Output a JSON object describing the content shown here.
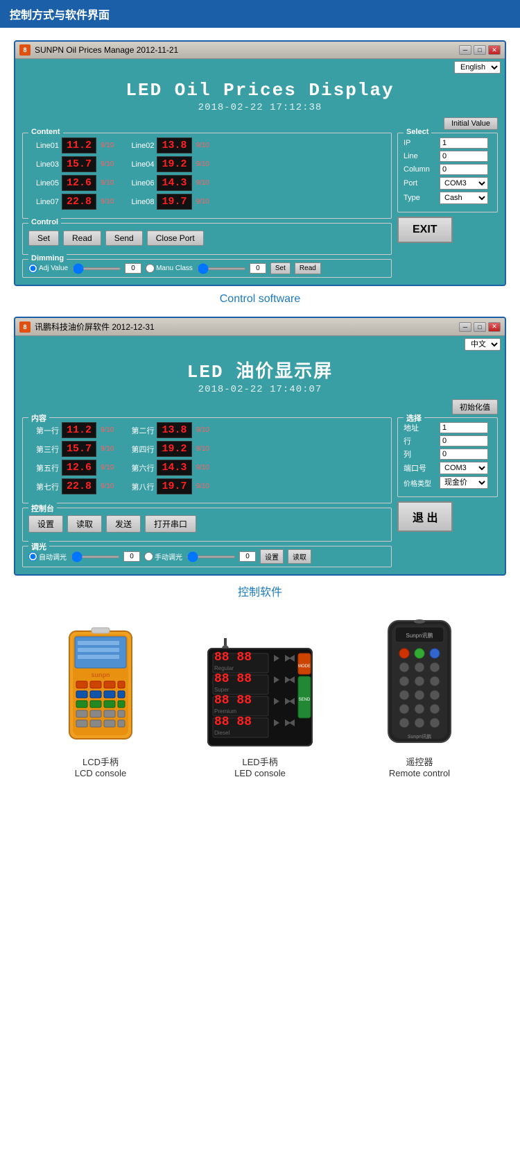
{
  "header": {
    "title": "控制方式与软件界面"
  },
  "window1": {
    "titlebar": "SUNPN Oil Prices Manage 2012-11-21",
    "lang": "English",
    "main_title": "LED Oil Prices Display",
    "datetime": "2018-02-22    17:12:38",
    "initial_value_btn": "Initial Value",
    "content_label": "Content",
    "lines": [
      {
        "label": "Line01",
        "price": "11.2",
        "fraction": "9/10"
      },
      {
        "label": "Line02",
        "price": "13.8",
        "fraction": "9/10"
      },
      {
        "label": "Line03",
        "price": "15.7",
        "fraction": "9/10"
      },
      {
        "label": "Line04",
        "price": "19.2",
        "fraction": "9/10"
      },
      {
        "label": "Line05",
        "price": "12.6",
        "fraction": "9/10"
      },
      {
        "label": "Line06",
        "price": "14.3",
        "fraction": "9/10"
      },
      {
        "label": "Line07",
        "price": "22.8",
        "fraction": "9/10"
      },
      {
        "label": "Line08",
        "price": "19.7",
        "fraction": "9/10"
      }
    ],
    "select_label": "Select",
    "ip_label": "IP",
    "ip_value": "1",
    "line_label": "Line",
    "line_value": "0",
    "column_label": "Column",
    "column_value": "0",
    "port_label": "Port",
    "port_value": "COM3",
    "type_label": "Type",
    "type_value": "Cash",
    "control_label": "Control",
    "btn_set": "Set",
    "btn_read": "Read",
    "btn_send": "Send",
    "btn_close_port": "Close Port",
    "btn_exit": "EXIT",
    "dimming_label": "Dimming",
    "adj_value_label": "Adj Value",
    "adj_value": "0",
    "manu_class_label": "Manu Class",
    "manu_class_value": "0",
    "dim_set": "Set",
    "dim_read": "Read"
  },
  "caption1": "Control software",
  "window2": {
    "titlebar": "讯鹏科技油价屏软件 2012-12-31",
    "lang": "中文",
    "main_title": "LED  油价显示屏",
    "datetime": "2018-02-22    17:40:07",
    "initial_value_btn": "初始化值",
    "content_label": "内容",
    "lines": [
      {
        "label": "第一行",
        "price": "11.2",
        "fraction": "9/10"
      },
      {
        "label": "第二行",
        "price": "13.8",
        "fraction": "9/10"
      },
      {
        "label": "第三行",
        "price": "15.7",
        "fraction": "9/10"
      },
      {
        "label": "第四行",
        "price": "19.2",
        "fraction": "9/10"
      },
      {
        "label": "第五行",
        "price": "12.6",
        "fraction": "9/10"
      },
      {
        "label": "第六行",
        "price": "14.3",
        "fraction": "9/10"
      },
      {
        "label": "第七行",
        "price": "22.8",
        "fraction": "9/10"
      },
      {
        "label": "第八行",
        "price": "19.7",
        "fraction": "9/10"
      }
    ],
    "select_label": "选择",
    "ip_label": "地址",
    "ip_value": "1",
    "line_label": "行",
    "line_value": "0",
    "column_label": "列",
    "column_value": "0",
    "port_label": "端口号",
    "port_value": "COM3",
    "type_label": "价格类型",
    "type_value": "现金价",
    "control_label": "控制台",
    "btn_set": "设置",
    "btn_read": "读取",
    "btn_send": "发送",
    "btn_close_port": "打开串口",
    "btn_exit": "退  出",
    "dimming_label": "调光",
    "adj_value_label": "自动调光",
    "adj_value": "0",
    "manu_class_label": "手动调光",
    "manu_class_value": "0",
    "dim_set": "设置",
    "dim_read": "读取"
  },
  "caption2": "控制软件",
  "devices": [
    {
      "name_zh": "LCD手柄",
      "name_en": "LCD console",
      "type": "lcd"
    },
    {
      "name_zh": "LED手柄",
      "name_en": "LED console",
      "type": "led"
    },
    {
      "name_zh": "遥控器",
      "name_en": "Remote control",
      "type": "remote"
    }
  ]
}
